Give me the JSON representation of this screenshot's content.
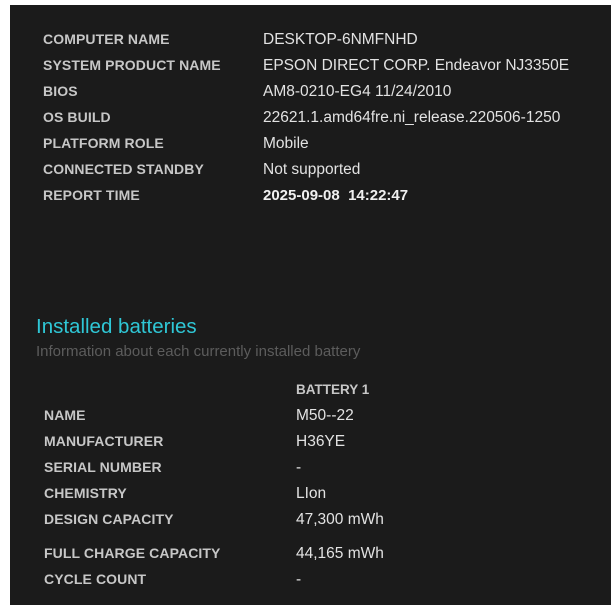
{
  "system_info": [
    {
      "label": "COMPUTER NAME",
      "value": "DESKTOP-6NMFNHD"
    },
    {
      "label": "SYSTEM PRODUCT NAME",
      "value": "EPSON DIRECT CORP. Endeavor NJ3350E"
    },
    {
      "label": "BIOS",
      "value": "AM8-0210-EG4 11/24/2010"
    },
    {
      "label": "OS BUILD",
      "value": "22621.1.amd64fre.ni_release.220506-1250"
    },
    {
      "label": "PLATFORM ROLE",
      "value": "Mobile"
    },
    {
      "label": "CONNECTED STANDBY",
      "value": "Not supported"
    },
    {
      "label": "REPORT TIME",
      "value": "2025-09-08  14:22:47"
    }
  ],
  "installed_batteries": {
    "title": "Installed batteries",
    "subtitle": "Information about each currently installed battery",
    "column_header": "BATTERY 1",
    "rows": [
      {
        "label": "NAME",
        "value": "M50--22"
      },
      {
        "label": "MANUFACTURER",
        "value": "H36YE"
      },
      {
        "label": "SERIAL NUMBER",
        "value": "-"
      },
      {
        "label": "CHEMISTRY",
        "value": "LIon"
      },
      {
        "label": "DESIGN CAPACITY",
        "value": "47,300 mWh"
      },
      {
        "label": "FULL CHARGE CAPACITY",
        "value": "44,165 mWh"
      },
      {
        "label": "CYCLE COUNT",
        "value": "-"
      }
    ]
  },
  "colors": {
    "background": "#1b1b1b",
    "label_text": "#c7c7c7",
    "value_text": "#e2e2e2",
    "section_title": "#2fc7d6",
    "section_subtitle": "#5c5c5c"
  }
}
